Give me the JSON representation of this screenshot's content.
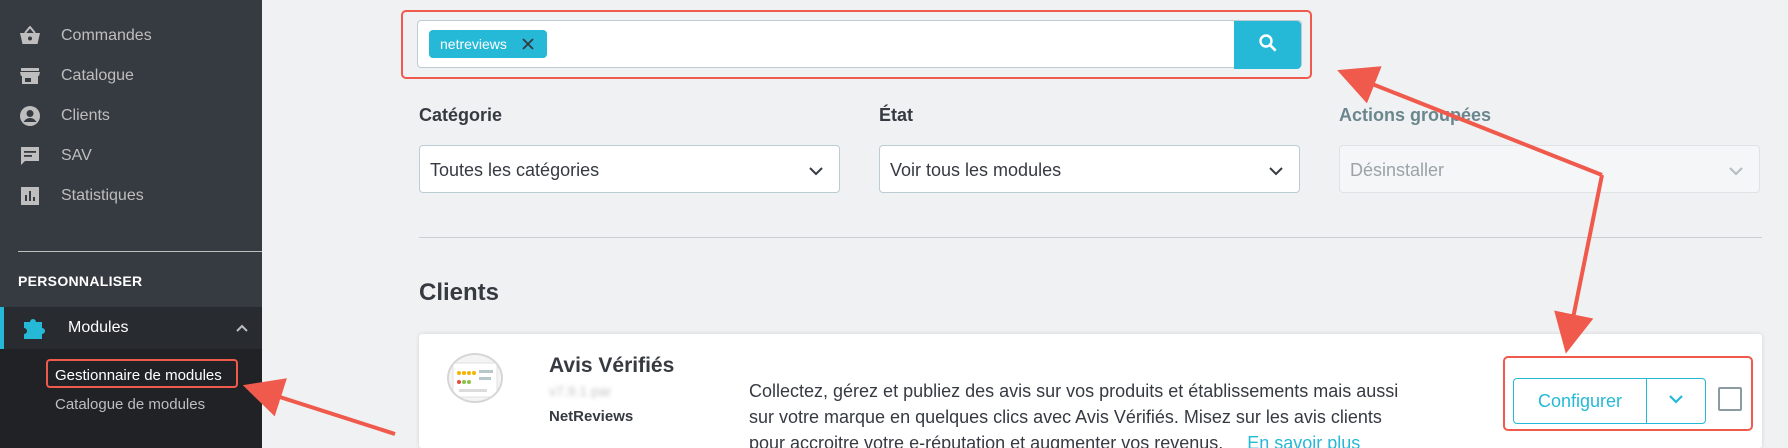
{
  "sidebar": {
    "items": [
      {
        "label": "Commandes",
        "icon": "basket-icon"
      },
      {
        "label": "Catalogue",
        "icon": "store-icon"
      },
      {
        "label": "Clients",
        "icon": "account-circle-icon"
      },
      {
        "label": "SAV",
        "icon": "chat-icon"
      },
      {
        "label": "Statistiques",
        "icon": "bar-chart-icon"
      }
    ],
    "section_title": "PERSONNALISER",
    "modules_label": "Modules",
    "submenu": {
      "active": "Gestionnaire de modules",
      "other": "Catalogue de modules"
    }
  },
  "search": {
    "chip": "netreviews"
  },
  "filters": {
    "category": {
      "label": "Catégorie",
      "value": "Toutes les catégories"
    },
    "state": {
      "label": "État",
      "value": "Voir tous les modules"
    },
    "bulk": {
      "label": "Actions groupées",
      "value": "Désinstaller"
    }
  },
  "category_title": "Clients",
  "module": {
    "name": "Avis Vérifiés",
    "version": "v7.9.1 par",
    "author": "NetReviews",
    "description": "Collectez, gérez et publiez des avis sur vos produits et établissements mais aussi sur votre marque en quelques clics avec Avis Vérifiés. Misez sur les avis clients pour accroitre votre e-réputation et augmenter vos revenus.",
    "more_link": "En savoir plus",
    "configure_label": "Configurer"
  },
  "colors": {
    "accent": "#25b9d7",
    "sidebar_bg": "#363a41",
    "annotation": "#f05a4c"
  }
}
